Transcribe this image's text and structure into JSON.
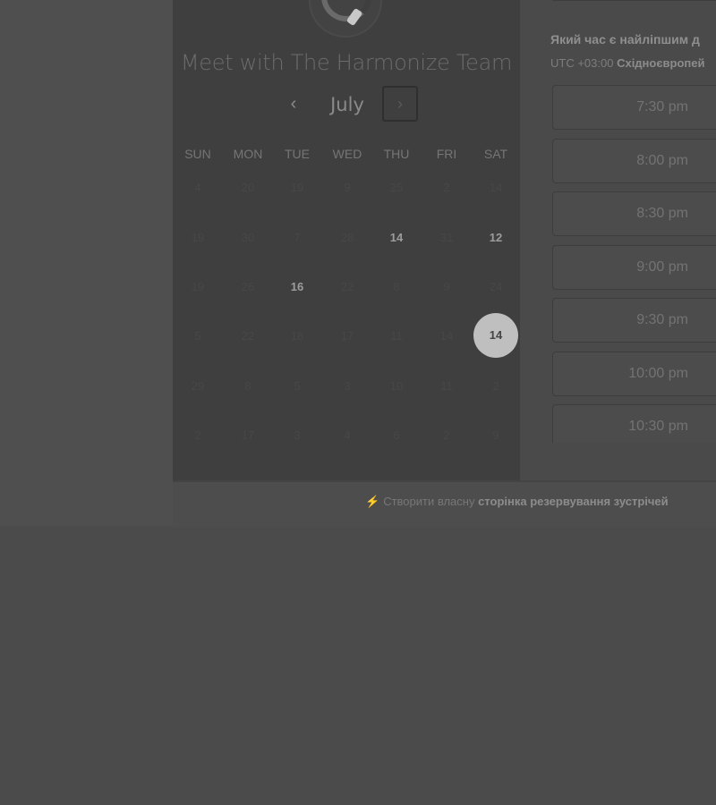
{
  "calendar": {
    "title": "Meet with The Harmonize Team",
    "month": "July",
    "prev_glyph": "‹",
    "next_glyph": "›",
    "weekdays": [
      "SUN",
      "MON",
      "TUE",
      "WED",
      "THU",
      "FRI",
      "SAT"
    ],
    "weeks": [
      [
        {
          "d": "4"
        },
        {
          "d": "20"
        },
        {
          "d": "19"
        },
        {
          "d": "9"
        },
        {
          "d": "25"
        },
        {
          "d": "2"
        },
        {
          "d": "14"
        }
      ],
      [
        {
          "d": "19"
        },
        {
          "d": "30"
        },
        {
          "d": "7"
        },
        {
          "d": "28"
        },
        {
          "d": "14",
          "avail": true
        },
        {
          "d": "31"
        },
        {
          "d": "12",
          "avail": true
        }
      ],
      [
        {
          "d": "19"
        },
        {
          "d": "26"
        },
        {
          "d": "16",
          "avail": true
        },
        {
          "d": "22"
        },
        {
          "d": "8"
        },
        {
          "d": "9"
        },
        {
          "d": "24"
        }
      ],
      [
        {
          "d": "5"
        },
        {
          "d": "22"
        },
        {
          "d": "18"
        },
        {
          "d": "17"
        },
        {
          "d": "11"
        },
        {
          "d": "14"
        },
        {
          "d": "14",
          "selected": true
        }
      ],
      [
        {
          "d": "29"
        },
        {
          "d": "8"
        },
        {
          "d": "5"
        },
        {
          "d": "3"
        },
        {
          "d": "10"
        },
        {
          "d": "11"
        },
        {
          "d": "2"
        }
      ],
      [
        {
          "d": "2"
        },
        {
          "d": "17"
        },
        {
          "d": "3"
        },
        {
          "d": "4"
        },
        {
          "d": "6"
        },
        {
          "d": "2"
        },
        {
          "d": "9"
        }
      ]
    ]
  },
  "times": {
    "heading": "Який час є найліпшим д",
    "tz_offset": "UTC +03:00",
    "tz_name": "Східноєвропей",
    "slots": [
      "7:30 pm",
      "8:00 pm",
      "8:30 pm",
      "9:00 pm",
      "9:30 pm",
      "10:00 pm",
      "10:30 pm"
    ]
  },
  "footer": {
    "icon": "spark-icon",
    "prefix": "Створити власну",
    "link": "сторінка резервування зустрічей"
  }
}
